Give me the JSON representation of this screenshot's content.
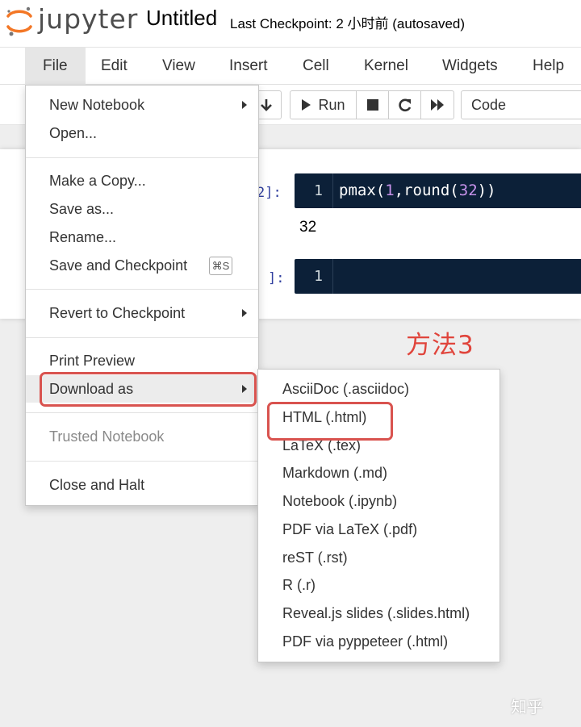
{
  "header": {
    "logo_text": "jupyter",
    "notebook_title": "Untitled",
    "checkpoint_status": "Last Checkpoint: 2 小时前   (autosaved)"
  },
  "menubar": {
    "items": [
      "File",
      "Edit",
      "View",
      "Insert",
      "Cell",
      "Kernel",
      "Widgets",
      "Help"
    ],
    "open_menu": "File"
  },
  "toolbar": {
    "run_label": "Run",
    "cell_type": "Code"
  },
  "cells": [
    {
      "prompt": "2]:",
      "line_number": "1",
      "code_fn1": "pmax",
      "code_p1": "(",
      "code_n1": "1",
      "code_mid": ",round(",
      "code_n2": "32",
      "code_end": "))",
      "output": "32"
    },
    {
      "prompt": "]:",
      "line_number": "1"
    }
  ],
  "file_menu": {
    "items": [
      {
        "label": "New Notebook",
        "submenu": true
      },
      {
        "label": "Open..."
      },
      {
        "label": "Make a Copy..."
      },
      {
        "label": "Save as..."
      },
      {
        "label": "Rename..."
      },
      {
        "label": "Save and Checkpoint",
        "shortcut": "⌘S"
      },
      {
        "label": "Revert to Checkpoint",
        "submenu": true
      },
      {
        "label": "Print Preview"
      },
      {
        "label": "Download as",
        "submenu": true,
        "highlighted": true
      },
      {
        "label": "Trusted Notebook",
        "disabled": true
      },
      {
        "label": "Close and Halt"
      }
    ]
  },
  "download_submenu": {
    "items": [
      "AsciiDoc (.asciidoc)",
      "HTML (.html)",
      "LaTeX (.tex)",
      "Markdown (.md)",
      "Notebook (.ipynb)",
      "PDF via LaTeX (.pdf)",
      "reST (.rst)",
      "R (.r)",
      "Reveal.js slides (.slides.html)",
      "PDF via pyppeteer (.html)"
    ]
  },
  "annotation": "方法3",
  "watermark": "知乎",
  "colors": {
    "highlight_box": "#d9534f",
    "annotation": "#e0453c",
    "code_background": "#0c2038",
    "logo_orange": "#f37726"
  }
}
